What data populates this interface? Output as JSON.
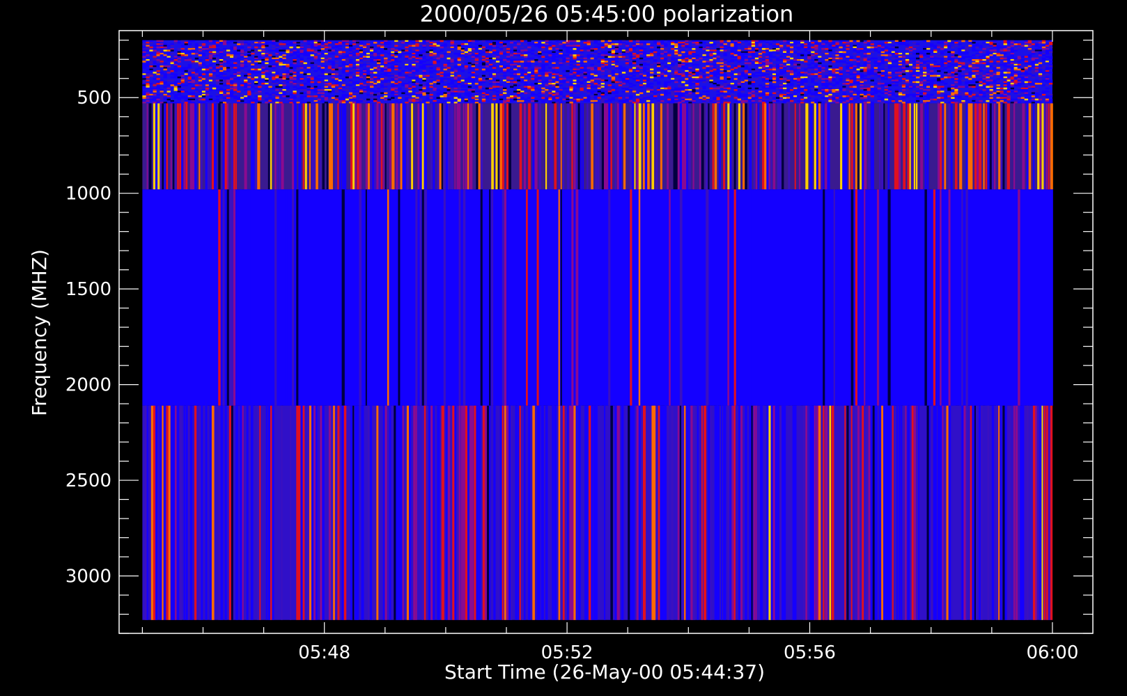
{
  "chart_data": {
    "type": "heatmap",
    "title": "2000/05/26 05:45:00 polarization",
    "xlabel": "Start Time (26-May-00 05:44:37)",
    "ylabel": "Frequency (MHZ)",
    "x_range": [
      "05:44:37",
      "06:00:40"
    ],
    "x_major_ticks": [
      "05:48",
      "05:52",
      "05:56",
      "06:00"
    ],
    "x_minor_tick_interval_minutes": 1,
    "ylim": [
      3300,
      150
    ],
    "y_inverted": true,
    "y_major_ticks": [
      500,
      1000,
      1500,
      2000,
      2500,
      3000
    ],
    "y_minor_tick_interval": 100,
    "data_extent": {
      "time_start": "05:45:00",
      "time_end": "06:00:00",
      "freq_min": 200,
      "freq_max": 3230
    },
    "bands": [
      {
        "freq_from": 200,
        "freq_to": 530,
        "pattern": "speckled noise",
        "dominant_color": "#1a10e8"
      },
      {
        "freq_from": 530,
        "freq_to": 980,
        "pattern": "vertical stripes",
        "dominant_color": "#3a1a90"
      },
      {
        "freq_from": 980,
        "freq_to": 2110,
        "pattern": "vertical stripes",
        "dominant_color": "#1400ff"
      },
      {
        "freq_from": 2110,
        "freq_to": 3230,
        "pattern": "vertical stripes",
        "dominant_color": "#3010c8"
      }
    ],
    "colormap": [
      "#000040",
      "#1400ff",
      "#3a10c0",
      "#8a0a90",
      "#e01020",
      "#ff6a00",
      "#ffd000"
    ],
    "grid": false,
    "background_color": "#000000",
    "axis_color": "#ffffff"
  }
}
